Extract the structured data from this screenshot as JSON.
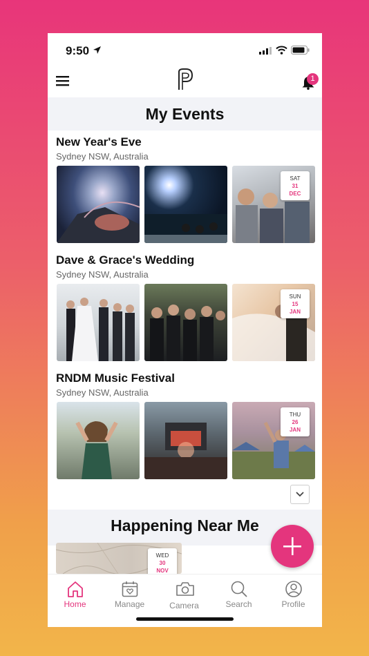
{
  "status_bar": {
    "time": "9:50"
  },
  "notifications": {
    "count": "1"
  },
  "my_events": {
    "heading": "My Events",
    "events": [
      {
        "title": "New Year's Eve",
        "location": "Sydney NSW, Australia",
        "date": {
          "dow": "SAT",
          "day": "31",
          "month": "DEC"
        }
      },
      {
        "title": "Dave & Grace's Wedding",
        "location": "Sydney NSW, Australia",
        "date": {
          "dow": "SUN",
          "day": "15",
          "month": "JAN"
        }
      },
      {
        "title": "RNDM Music Festival",
        "location": "Sydney NSW, Australia",
        "date": {
          "dow": "THU",
          "day": "26",
          "month": "JAN"
        }
      }
    ]
  },
  "nearby": {
    "heading": "Happening Near Me",
    "first_event_date": {
      "dow": "WED",
      "day": "30",
      "month": "NOV"
    }
  },
  "tabs": [
    {
      "label": "Home",
      "icon": "home-icon",
      "active": true
    },
    {
      "label": "Manage",
      "icon": "calendar-heart-icon",
      "active": false
    },
    {
      "label": "Camera",
      "icon": "camera-icon",
      "active": false
    },
    {
      "label": "Search",
      "icon": "search-icon",
      "active": false
    },
    {
      "label": "Profile",
      "icon": "profile-icon",
      "active": false
    }
  ],
  "colors": {
    "accent": "#e4357d",
    "section_bg": "#f2f3f7",
    "inactive_tab": "#888888"
  }
}
